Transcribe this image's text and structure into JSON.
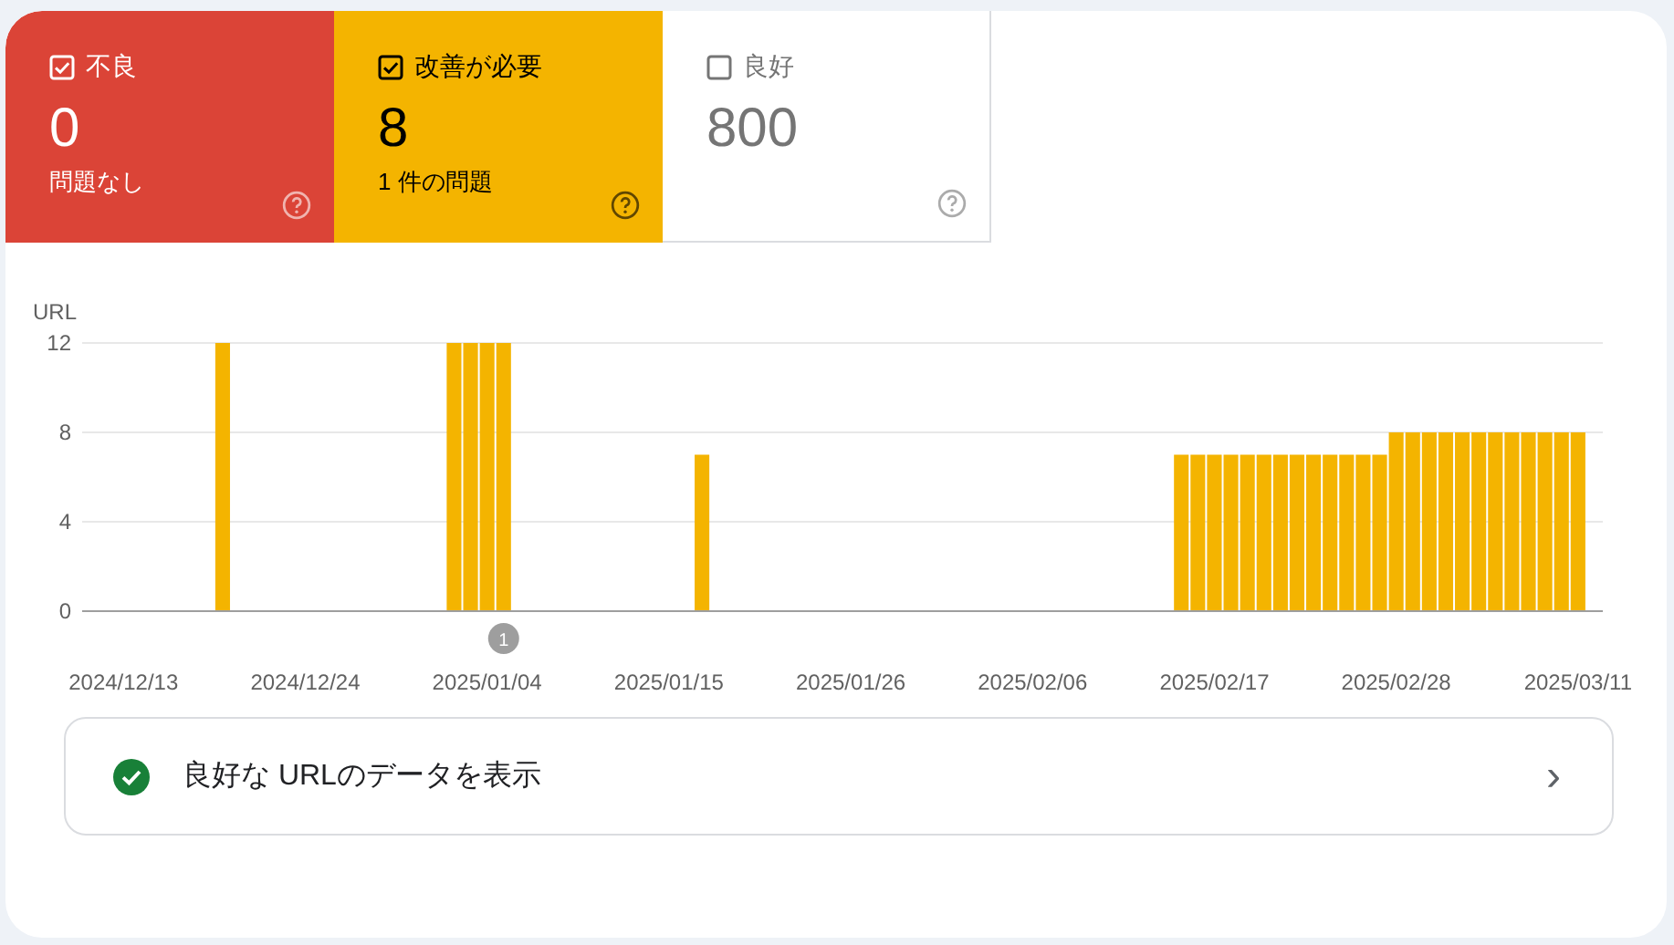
{
  "tiles": [
    {
      "kind": "poor",
      "label": "不良",
      "selected": true,
      "count": "0",
      "note": "問題なし"
    },
    {
      "kind": "needs_improvement",
      "label": "改善が必要",
      "selected": true,
      "count": "8",
      "note": "1 件の問題"
    },
    {
      "kind": "good",
      "label": "良好",
      "selected": false,
      "count": "800"
    }
  ],
  "chart": {
    "chart_data": {
      "type": "bar",
      "ylabel": "URL",
      "ylim": [
        0,
        12
      ],
      "yticks": [
        0,
        4,
        8,
        12
      ],
      "categories": [
        null,
        null,
        "2024/12/13",
        null,
        null,
        null,
        null,
        null,
        null,
        null,
        null,
        null,
        null,
        "2024/12/24",
        null,
        null,
        null,
        null,
        null,
        null,
        null,
        null,
        null,
        null,
        "2025/01/04",
        null,
        null,
        null,
        null,
        null,
        null,
        null,
        null,
        null,
        null,
        "2025/01/15",
        null,
        null,
        null,
        null,
        null,
        null,
        null,
        null,
        null,
        null,
        "2025/01/26",
        null,
        null,
        null,
        null,
        null,
        null,
        null,
        null,
        null,
        null,
        "2025/02/06",
        null,
        null,
        null,
        null,
        null,
        null,
        null,
        null,
        null,
        null,
        "2025/02/17",
        null,
        null,
        null,
        null,
        null,
        null,
        null,
        null,
        null,
        null,
        "2025/02/28",
        null,
        null,
        null,
        null,
        null,
        null,
        null,
        null,
        null,
        null,
        "2025/03/11",
        null
      ],
      "series": [
        {
          "color": "#f4b400",
          "values": [
            0,
            0,
            0,
            0,
            0,
            0,
            0,
            0,
            12,
            0,
            0,
            0,
            0,
            0,
            0,
            0,
            0,
            0,
            0,
            0,
            0,
            0,
            12,
            12,
            12,
            12,
            0,
            0,
            0,
            0,
            0,
            0,
            0,
            0,
            0,
            0,
            0,
            7,
            0,
            0,
            0,
            0,
            0,
            0,
            0,
            0,
            0,
            0,
            0,
            0,
            0,
            0,
            0,
            0,
            0,
            0,
            0,
            0,
            0,
            0,
            0,
            0,
            0,
            0,
            0,
            0,
            7,
            7,
            7,
            7,
            7,
            7,
            7,
            7,
            7,
            7,
            7,
            7,
            7,
            8,
            8,
            8,
            8,
            8,
            8,
            8,
            8,
            8,
            8,
            8,
            8,
            0
          ]
        }
      ]
    },
    "marker": {
      "label": "1"
    }
  },
  "link": {
    "label": "良好な URLのデータを表示",
    "chevron": "›"
  }
}
